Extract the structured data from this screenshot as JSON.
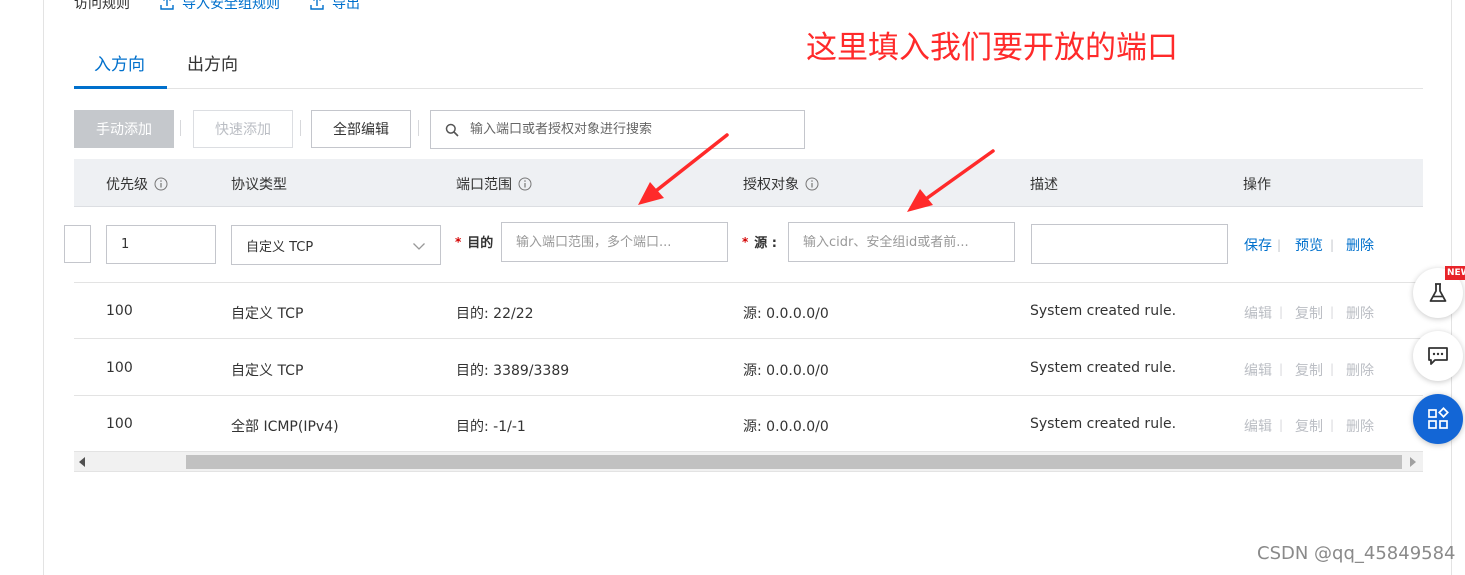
{
  "header": {
    "section_title": "访问规则",
    "import_link": "导入安全组规则",
    "export_link": "导出"
  },
  "tabs": [
    {
      "label": "入方向",
      "active": true
    },
    {
      "label": "出方向",
      "active": false
    }
  ],
  "toolbar": {
    "manual_add": "手动添加",
    "quick_add": "快速添加",
    "edit_all": "全部编辑",
    "search_placeholder": "输入端口或者授权对象进行搜索"
  },
  "table": {
    "columns": {
      "priority": "优先级",
      "protocol": "协议类型",
      "port_range": "端口范围",
      "auth_object": "授权对象",
      "description": "描述",
      "actions": "操作"
    },
    "edit_row": {
      "priority_value": "1",
      "protocol_value": "自定义 TCP",
      "dest_label": "目的",
      "dest_placeholder": "输入端口范围，多个端口...",
      "source_label": "源 :",
      "source_placeholder": "输入cidr、安全组id或者前...",
      "description_value": "",
      "save": "保存",
      "preview": "预览",
      "delete": "删除"
    },
    "rows": [
      {
        "priority": "100",
        "protocol": "自定义 TCP",
        "port": "目的: 22/22",
        "source": "源: 0.0.0.0/0",
        "description": "System created rule.",
        "edit": "编辑",
        "copy": "复制",
        "delete": "删除"
      },
      {
        "priority": "100",
        "protocol": "自定义 TCP",
        "port": "目的: 3389/3389",
        "source": "源: 0.0.0.0/0",
        "description": "System created rule.",
        "edit": "编辑",
        "copy": "复制",
        "delete": "删除"
      },
      {
        "priority": "100",
        "protocol": "全部 ICMP(IPv4)",
        "port": "目的: -1/-1",
        "source": "源: 0.0.0.0/0",
        "description": "System created rule.",
        "edit": "编辑",
        "copy": "复制",
        "delete": "删除"
      }
    ]
  },
  "annotation": "这里填入我们要开放的端口",
  "float_buttons": {
    "badge": "NEW",
    "lab_icon": "flask-icon",
    "chat_icon": "chat-icon",
    "apps_icon": "apps-icon"
  },
  "watermark": "CSDN @qq_45849584",
  "colors": {
    "link_blue": "#0070cc",
    "annotation_red": "#ff2a2a",
    "float_blue": "#1366d6"
  }
}
